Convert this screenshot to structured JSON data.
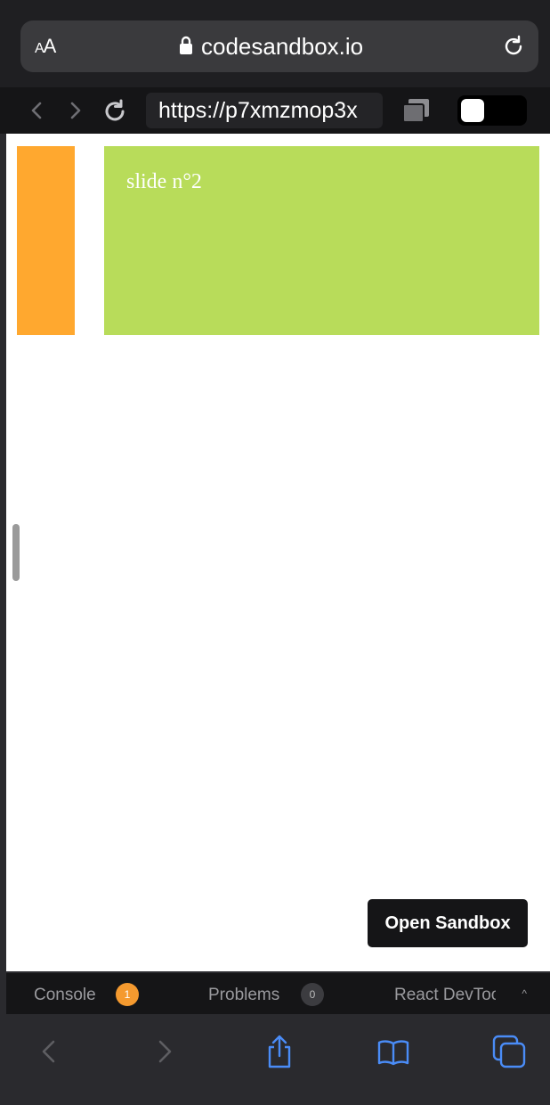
{
  "safari": {
    "text_size_small": "A",
    "text_size_large": "A",
    "domain": "codesandbox.io"
  },
  "csb": {
    "url": "https://p7xmzmop3x"
  },
  "preview": {
    "slide_label": "slide n°2",
    "open_sandbox_label": "Open Sandbox"
  },
  "devtools": {
    "console_label": "Console",
    "console_count": "1",
    "problems_label": "Problems",
    "problems_count": "0",
    "react_label": "React DevToo"
  },
  "colors": {
    "slide_prev": "#ffa82f",
    "slide_current": "#b8dc5a",
    "console_badge": "#f59a2f",
    "problems_badge": "#3c3c40",
    "ios_blue": "#4a8cf7"
  }
}
